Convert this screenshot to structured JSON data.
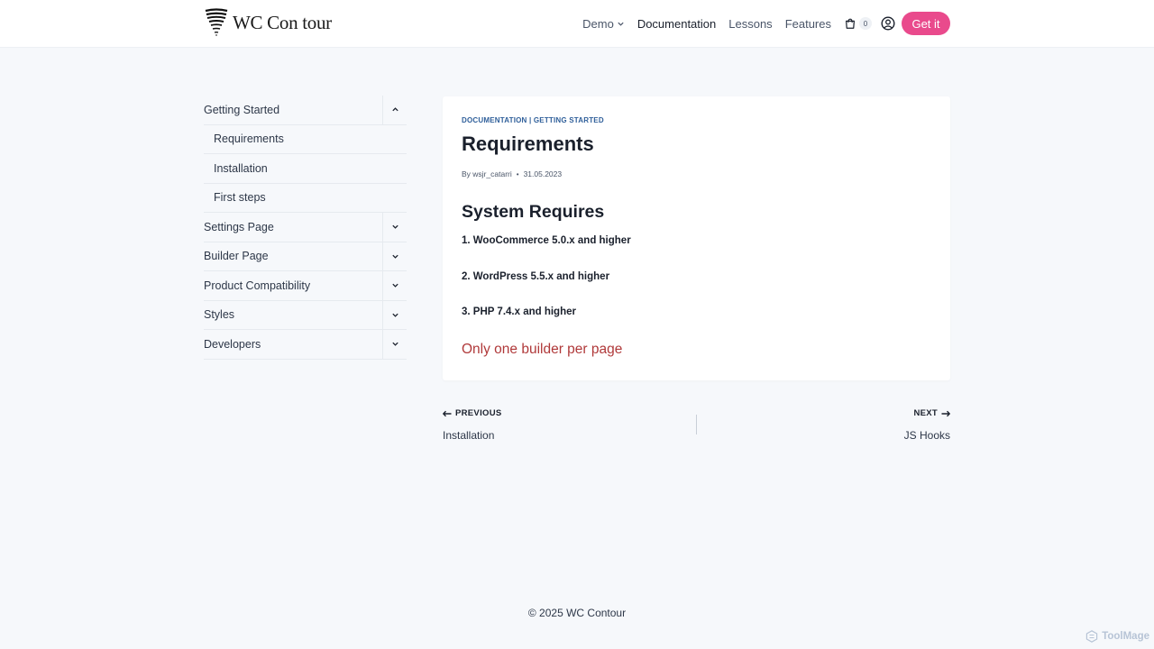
{
  "header": {
    "logo_text": "WC Con tour",
    "nav": [
      {
        "label": "Demo"
      },
      {
        "label": "Documentation"
      },
      {
        "label": "Lessons"
      },
      {
        "label": "Features"
      }
    ],
    "cart_count": "0",
    "cta_label": "Get it"
  },
  "sidebar": {
    "items": [
      {
        "label": "Getting Started",
        "toggle": "chevron-up-icon"
      },
      {
        "label": "Requirements"
      },
      {
        "label": "Installation"
      },
      {
        "label": "First steps"
      },
      {
        "label": "Settings Page",
        "toggle": "chevron-down-icon"
      },
      {
        "label": "Builder Page",
        "toggle": "chevron-down-icon"
      },
      {
        "label": "Product Compatibility",
        "toggle": "chevron-down-icon"
      },
      {
        "label": "Styles",
        "toggle": "chevron-down-icon"
      },
      {
        "label": "Developers",
        "toggle": "chevron-down-icon"
      }
    ]
  },
  "post": {
    "categories": [
      "DOCUMENTATION",
      "GETTING STARTED"
    ],
    "category_separator": "|",
    "title": "Requirements",
    "by": "By",
    "author": "wsjr_catarri",
    "date": "31.05.2023",
    "heading": "System Requires",
    "requirements": [
      "1. WooCommerce 5.0.x and higher",
      "2. WordPress 5.5.x and higher",
      "3. PHP 7.4.x and higher"
    ],
    "warning": "Only one builder per page"
  },
  "post_nav": {
    "prev_label": "PREVIOUS",
    "prev_title": "Installation",
    "next_label": "NEXT",
    "next_title": "JS Hooks"
  },
  "footer": {
    "copyright": "© 2025 WC Contour"
  },
  "watermark": "ToolMage",
  "colors": {
    "accent": "#e94a8c",
    "category_link": "#2f5f9a",
    "warning": "#b0393a",
    "background": "#f6f8fb"
  }
}
